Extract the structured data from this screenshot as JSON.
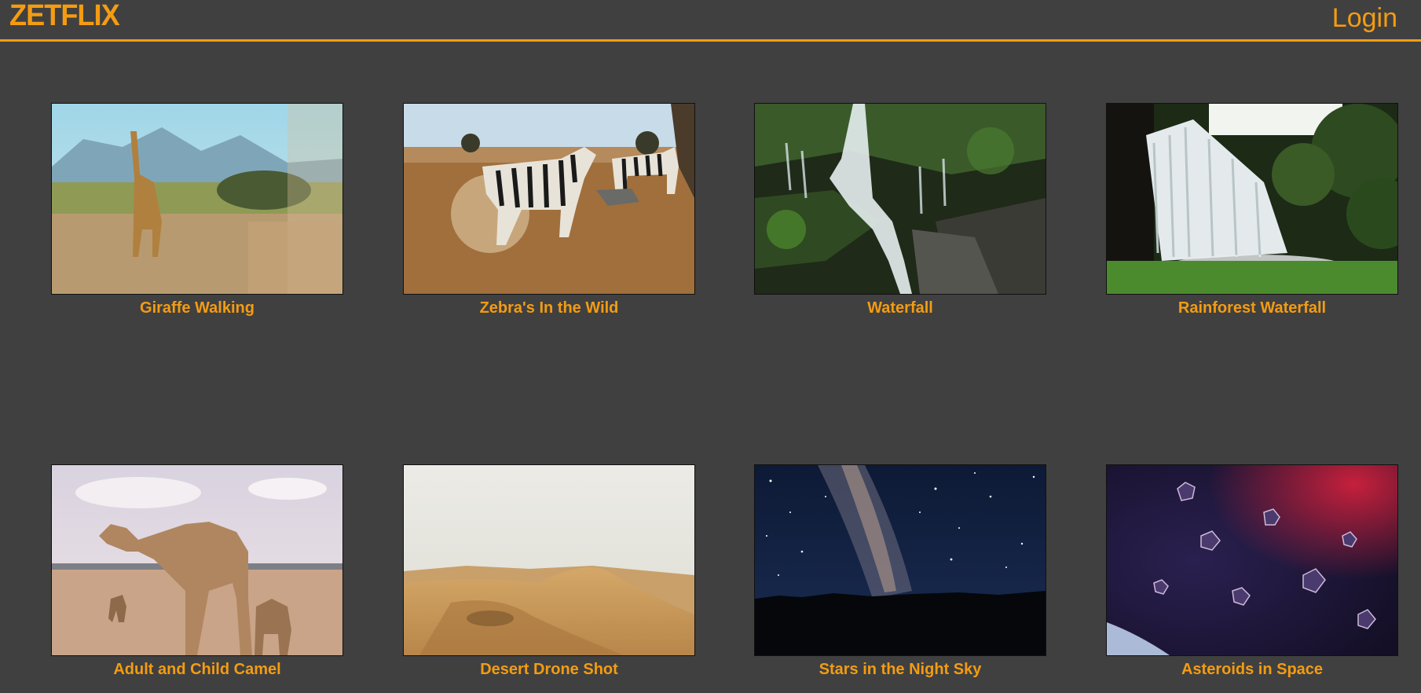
{
  "header": {
    "logo_text": "ZETFLIX",
    "login_label": "Login"
  },
  "videos": [
    {
      "title": "Giraffe Walking"
    },
    {
      "title": "Zebra's In the Wild"
    },
    {
      "title": "Waterfall"
    },
    {
      "title": "Rainforest Waterfall"
    },
    {
      "title": "Adult and Child Camel"
    },
    {
      "title": "Desert Drone Shot"
    },
    {
      "title": "Stars in the Night Sky"
    },
    {
      "title": "Asteroids in Space"
    }
  ],
  "colors": {
    "accent": "#f39c12",
    "background": "#404040"
  }
}
